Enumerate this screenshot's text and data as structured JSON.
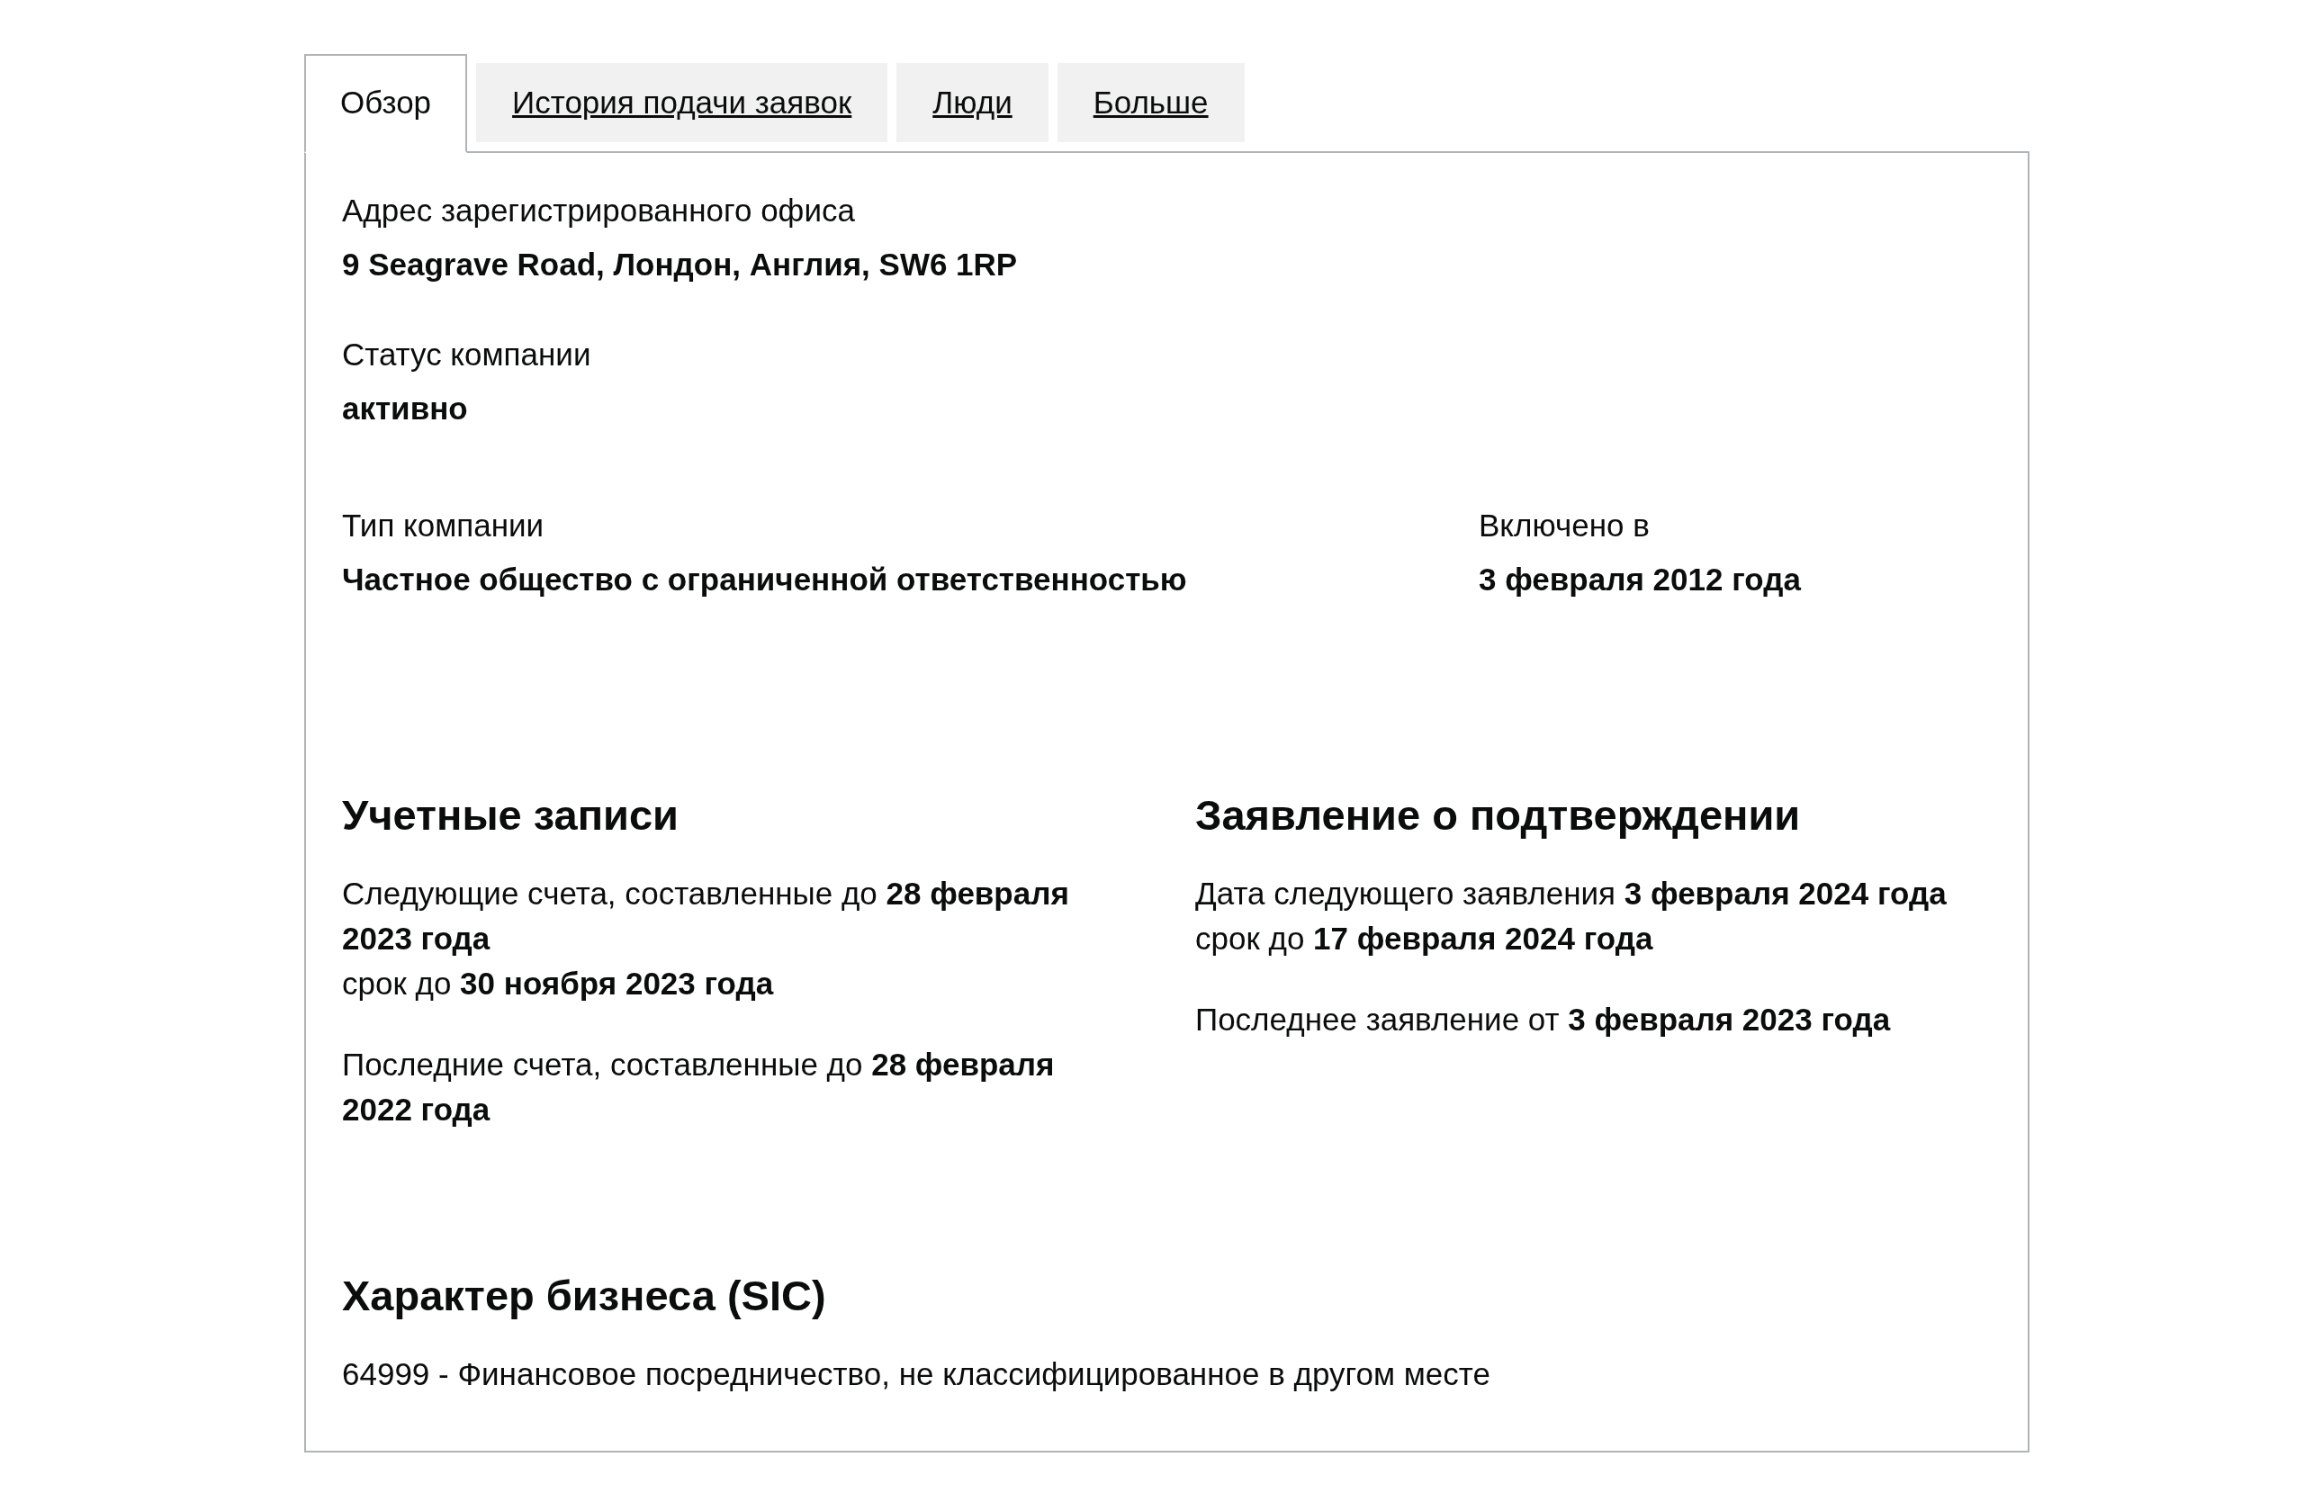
{
  "tabs": [
    {
      "label": "Обзор",
      "selected": true
    },
    {
      "label": "История подачи заявок",
      "selected": false
    },
    {
      "label": "Люди",
      "selected": false
    },
    {
      "label": "Больше",
      "selected": false
    }
  ],
  "registered_office": {
    "label": "Адрес зарегистрированного офиса",
    "value": "9 Seagrave Road, Лондон, Англия, SW6 1RP"
  },
  "company_status": {
    "label": "Статус компании",
    "value": "активно"
  },
  "company_type": {
    "label": "Тип компании",
    "value": "Частное общество с ограниченной ответственностью"
  },
  "incorporated": {
    "label": "Включено в",
    "value": "3 февраля 2012 года"
  },
  "accounts": {
    "heading": "Учетные записи",
    "paragraphs": [
      {
        "lines": [
          "Следующие счета, составленные до **28 февраля 2023 года**",
          "срок до **30 ноября 2023 года**"
        ]
      },
      {
        "lines": [
          "Последние счета, составленные до **28 февраля 2022 года**"
        ]
      }
    ]
  },
  "confirmation_statement": {
    "heading": "Заявление о подтверждении",
    "paragraphs": [
      {
        "lines": [
          "Дата следующего заявления **3 февраля 2024 года**",
          "срок до **17 февраля 2024 года**"
        ]
      },
      {
        "lines": [
          "Последнее заявление от **3 февраля 2023 года**"
        ]
      }
    ]
  },
  "nature_of_business": {
    "heading": "Характер бизнеса (SIC)",
    "text": "64999 - Финансовое посредничество, не классифицированное в другом месте"
  }
}
